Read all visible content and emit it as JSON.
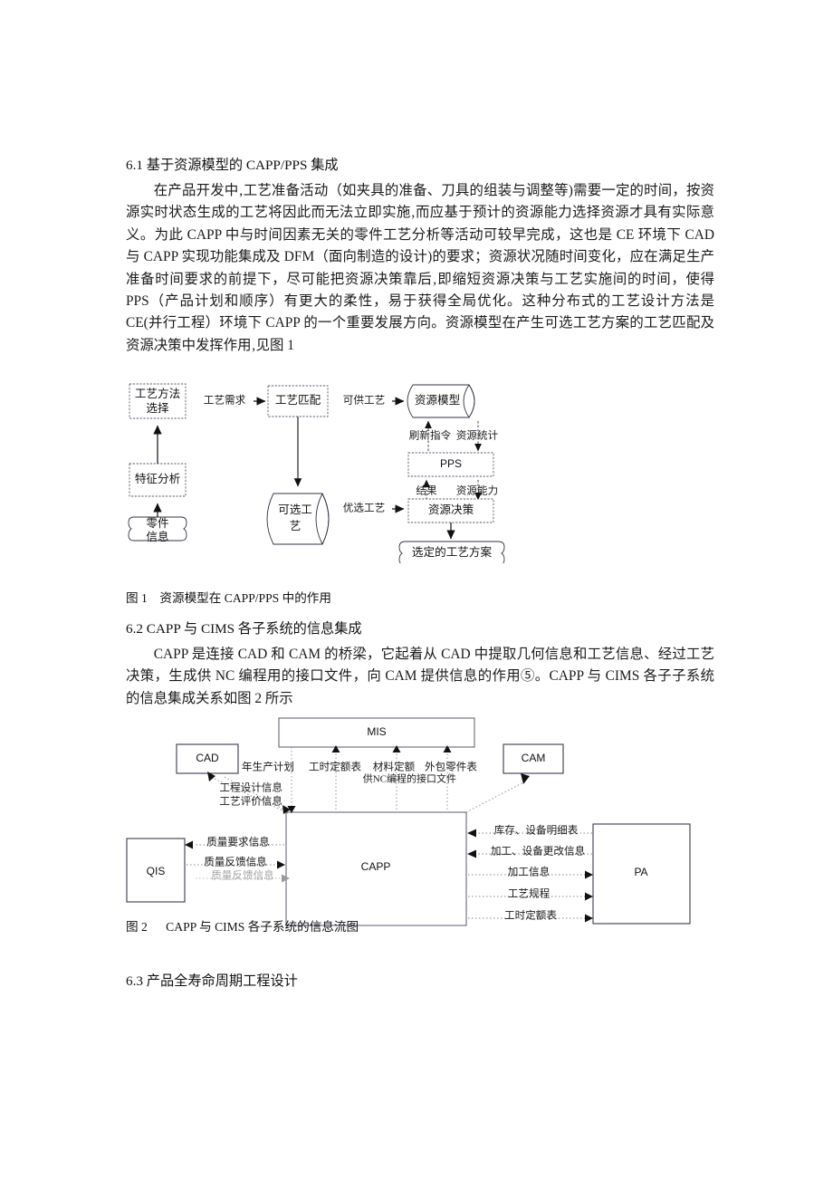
{
  "sections": {
    "s61_heading": "6.1  基于资源模型的 CAPP/PPS 集成",
    "s61_para": "在产品开发中‚工艺准备活动（如夹具的准备、刀具的组装与调整等)需要一定的时间，按资源实时状态生成的工艺将因此而无法立即实施‚而应基于预计的资源能力选择资源才具有实际意义。为此 CAPP 中与时间因素无关的零件工艺分析等活动可较早完成，这也是 CE 环境下 CAD 与 CAPP 实现功能集成及 DFM（面向制造的设计)的要求；资源状况随时间变化，应在满足生产准备时间要求的前提下，尽可能把资源决策靠后‚即缩短资源决策与工艺实施间的时间，使得 PPS（产品计划和顺序）有更大的柔性，易于获得全局优化。这种分布式的工艺设计方法是 CE(并行工程）环境下 CAPP 的一个重要发展方向。资源模型在产生可选工艺方案的工艺匹配及资源决策中发挥作用‚见图 1",
    "fig1_caption": "图 1    资源模型在 CAPP/PPS 中的作用",
    "s62_heading": "6.2  CAPP 与 CIMS 各子系统的信息集成",
    "s62_para": "CAPP 是连接 CAD 和 CAM 的桥梁，它起着从 CAD 中提取几何信息和工艺信息、经过工艺决策，生成供 NC 编程用的接口文件，向 CAM 提供信息的作用⑤。CAPP 与 CIMS 各子子系统的信息集成关系如图 2 所示",
    "fig2_caption": "图 2      CAPP 与 CIMS 各子系统的信息流图",
    "s63_heading": "6.3  产品全寿命周期工程设计"
  },
  "figure1": {
    "nodes": {
      "process_method_select": "工艺方法\n选择",
      "feature_analysis": "特征分析",
      "part_info": "零件\n信息",
      "process_match": "工艺匹配",
      "optional_process": "可选工\n艺",
      "resource_model": "资源模型",
      "pps": "PPS",
      "resource_decision": "资源决策",
      "selected_plan": "选定的工艺方案"
    },
    "edges": {
      "process_requirement": "工艺需求",
      "available_process": "可供工艺",
      "preferred_process": "优选工艺",
      "refresh_command": "刷新指令",
      "resource_statistics": "资源统计",
      "result": "结果",
      "resource_capability": "资源能力"
    }
  },
  "figure2": {
    "nodes": {
      "mis": "MIS",
      "cad": "CAD",
      "cam": "CAM",
      "qis": "QIS",
      "capp": "CAPP",
      "pa": "PA"
    },
    "edges": {
      "annual_production_plan": "年生产计划",
      "labor_quota_table": "工时定额表",
      "material_quota": "材料定额",
      "outsourced_parts_list": "外包零件表",
      "engineering_design_info": "工程设计信息",
      "process_evaluation_info": "工艺评价信息",
      "nc_interface_file": "供NC编程的接口文件",
      "quality_requirement_info": "质量要求信息",
      "quality_feedback_info": "质量反馈信息",
      "quality_feedback_info_ghost": "质量反馈信息",
      "inventory_equipment_list": "库存、设备明细表",
      "machining_equipment_change_info": "加工、设备更改信息",
      "machining_info": "加工信息",
      "process_spec": "工艺规程",
      "labor_quota_table_2": "工时定额表"
    }
  },
  "colors": {
    "ink": "#1a1a1a",
    "line": "#3a3a50",
    "dotted": "#7a7a7a",
    "ghost": "#9a9a9a"
  }
}
